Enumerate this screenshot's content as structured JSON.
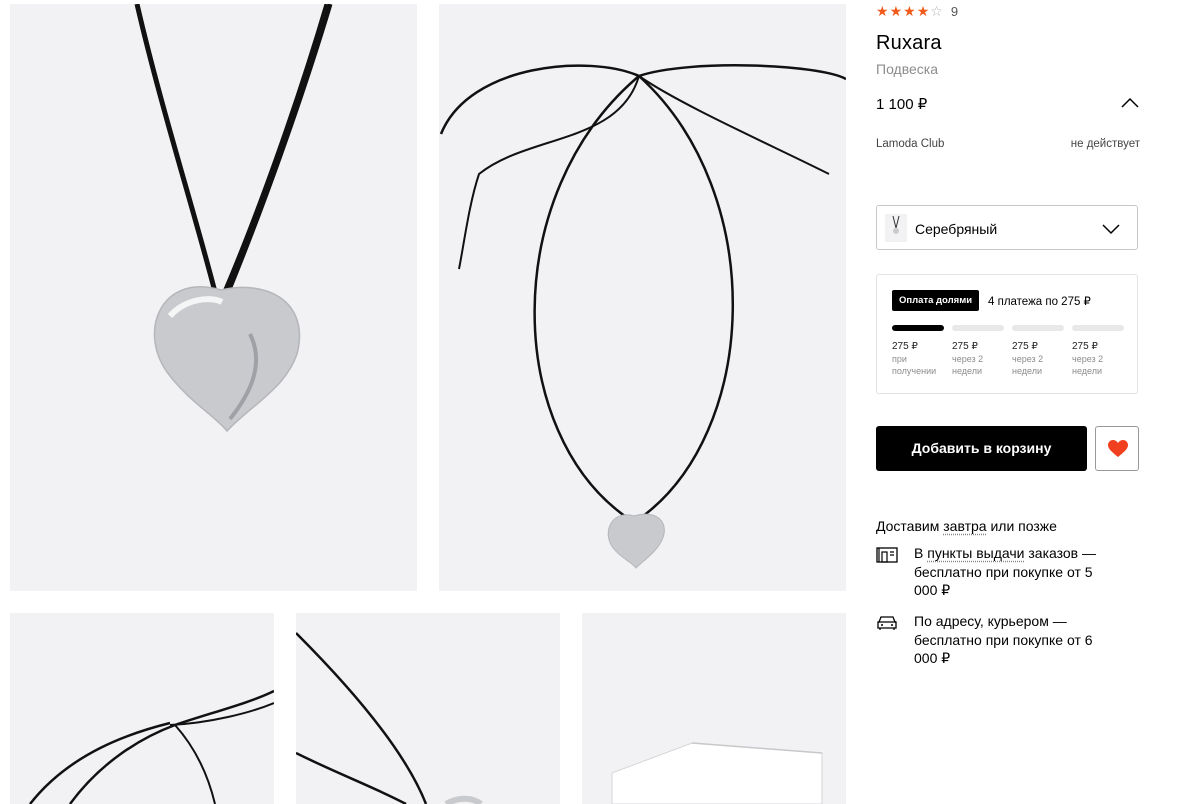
{
  "product": {
    "rating": 4,
    "rating_max": 5,
    "review_count": "9",
    "brand": "Ruxara",
    "type": "Подвеска",
    "price": "1 100 ₽",
    "club_label": "Lamoda Club",
    "club_status": "не действует"
  },
  "color_select": {
    "value": "Серебряный"
  },
  "split_payment": {
    "badge": "Оплата долями",
    "summary": "4 платежа по 275 ₽",
    "payments": [
      {
        "amount": "275 ₽",
        "when": "при получении"
      },
      {
        "amount": "275 ₽",
        "when": "через 2 недели"
      },
      {
        "amount": "275 ₽",
        "when": "через 2 недели"
      },
      {
        "amount": "275 ₽",
        "when": "через 2 недели"
      }
    ]
  },
  "actions": {
    "add_to_cart": "Добавить в корзину"
  },
  "delivery": {
    "title_prefix": "Доставим ",
    "title_link": "завтра",
    "title_suffix": " или позже",
    "pickup_prefix": "В ",
    "pickup_link": "пункты выдачи",
    "pickup_suffix": " заказов — бесплатно при покупке от 5 000 ₽",
    "courier_text": "По адресу, курьером — бесплатно при покупке от 6 000 ₽"
  },
  "colors": {
    "accent_star": "#f25a1c",
    "heart": "#f0401f",
    "button_bg": "#000000"
  },
  "icons": {
    "pickup": "pickup-point-icon",
    "courier": "car-icon",
    "favorite": "heart-icon"
  }
}
